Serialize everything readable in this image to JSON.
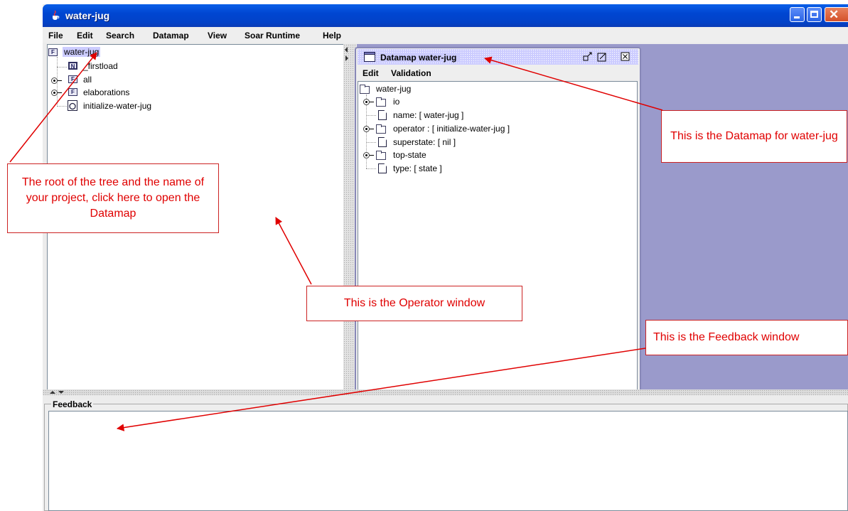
{
  "window": {
    "title": "water-jug",
    "controls": [
      "minimize",
      "maximize",
      "close"
    ]
  },
  "menubar": {
    "items": [
      "File",
      "Edit",
      "Search",
      "Datamap",
      "View",
      "Soar Runtime",
      "Help"
    ]
  },
  "operator_tree": {
    "root": "water-jug",
    "items": [
      {
        "label": "_firstload",
        "icon": "file-icon"
      },
      {
        "label": "all",
        "icon": "folder-icon"
      },
      {
        "label": "elaborations",
        "icon": "folder-icon"
      },
      {
        "label": "initialize-water-jug",
        "icon": "operator-icon"
      }
    ]
  },
  "datamap": {
    "title": "Datamap water-jug",
    "menu": [
      "Edit",
      "Validation"
    ],
    "tree": [
      "water-jug",
      "io",
      "name: [ water-jug ]",
      "operator : [ initialize-water-jug ]",
      "superstate: [ nil ]",
      "top-state",
      "type: [ state ]"
    ]
  },
  "feedback": {
    "label": "Feedback",
    "text": ""
  },
  "annotations": {
    "datamap": "This is the Datamap for water-jug",
    "root": "The root of the tree and the name of your project, click here to open the Datamap",
    "operator": "This is the Operator window",
    "feedback": "This is the Feedback window"
  },
  "colors": {
    "titlebar": "#0046d1",
    "desktop": "#9a9acb",
    "annotation": "#e00000"
  }
}
